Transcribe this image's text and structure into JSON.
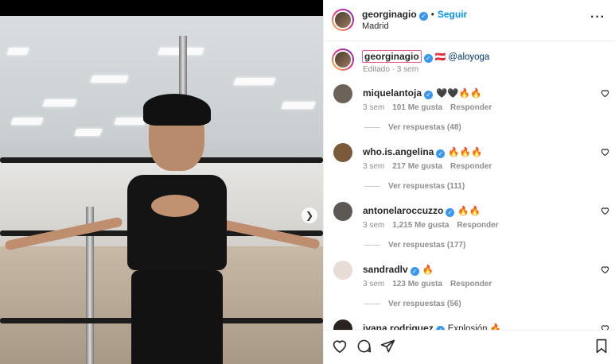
{
  "post": {
    "photo_alt": "",
    "next_icon": "chevron-right-icon"
  },
  "header": {
    "username": "georginagio",
    "verified_icon": "verified-badge-icon",
    "separator": "•",
    "follow_label": "Seguir",
    "location": "Madrid",
    "more_icon": "more-options-icon",
    "more_glyph": "···"
  },
  "caption": {
    "username": "georginagio",
    "flag": "🇦🇹",
    "mention": "@aloyoga",
    "meta": "Editado · 3 sem"
  },
  "comments": [
    {
      "username": "miquelantoja",
      "text": "🖤🖤🔥🔥",
      "time": "3 sem",
      "likes": "101 Me gusta",
      "reply": "Responder",
      "replies": "Ver respuestas (48)",
      "avatar_color": "#6d6257"
    },
    {
      "username": "who.is.angelina",
      "text": "🔥🔥🔥",
      "time": "3 sem",
      "likes": "217 Me gusta",
      "reply": "Responder",
      "replies": "Ver respuestas (111)",
      "avatar_color": "#7a5a3a"
    },
    {
      "username": "antonelaroccuzzo",
      "text": "🔥🔥",
      "time": "3 sem",
      "likes": "1,215 Me gusta",
      "reply": "Responder",
      "replies": "Ver respuestas (177)",
      "avatar_color": "#5c5955"
    },
    {
      "username": "sandradlv",
      "text": "🔥",
      "time": "3 sem",
      "likes": "123 Me gusta",
      "reply": "Responder",
      "replies": "Ver respuestas (56)",
      "avatar_color": "#e8dcd6"
    },
    {
      "username": "ivana.rodriguez",
      "text": "Explosión 🔥",
      "time": "",
      "likes": "",
      "reply": "",
      "replies": "",
      "avatar_color": "#2a2420"
    }
  ],
  "actions": {
    "like_icon": "heart-icon",
    "comment_icon": "comment-icon",
    "share_icon": "share-icon",
    "save_icon": "bookmark-icon"
  }
}
